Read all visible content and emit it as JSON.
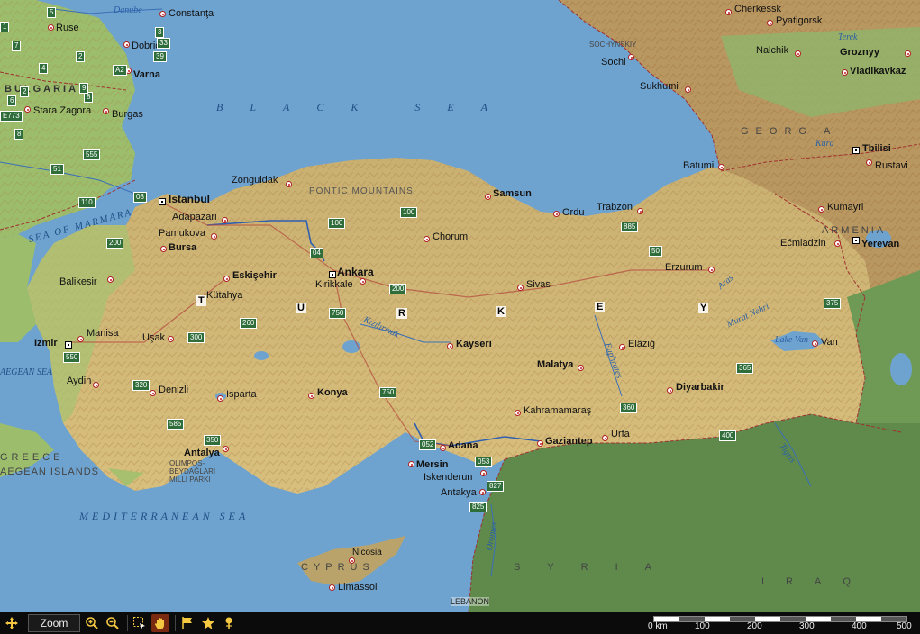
{
  "seas": {
    "black_sea": "BLACK SEA",
    "sea_of_marmara": "SEA OF MARMARA",
    "mediterranean": "MEDITERRANEAN SEA",
    "aegean": "AEGEAN SEA"
  },
  "countries": {
    "turkey": [
      "T",
      "U",
      "R",
      "K",
      "E",
      "Y"
    ],
    "bulgaria": "BULGARIA",
    "georgia": "GEORGIA",
    "armenia": "ARMENIA",
    "greece": "GREECE",
    "aegean_islands": "AEGEAN ISLANDS",
    "syria": "SYRIA",
    "iraq": "IRAQ",
    "cyprus": "CYPRUS",
    "lebanon": "LEBANON"
  },
  "regions": {
    "pontic": "PONTIC MOUNTAINS",
    "olimpos": [
      "OLIMPOS-",
      "BEYDAĞLARI",
      "MILLI PARKI"
    ],
    "sochynskiy": "SOCHYNSKIY"
  },
  "rivers": {
    "danube": "Danube",
    "terek": "Terek",
    "kura": "Kura",
    "kizilirmak": "Kızılırmak",
    "euphrates": "Euphrates",
    "murat": "Murat Nehri",
    "tigris": "Tigris",
    "orontes": "Orontes",
    "lake_van": "Lake Van",
    "aras": "Aras"
  },
  "cities": {
    "constanta": "Constanţa",
    "ruse": "Ruse",
    "dobrich": "Dobrich",
    "varna": "Varna",
    "stara_zagora": "Stara Zagora",
    "burgas": "Burgas",
    "istanbul": "Istanbul",
    "zonguldak": "Zonguldak",
    "samsun": "Samsun",
    "ordu": "Ordu",
    "trabzon": "Trabzon",
    "batumi": "Batumi",
    "sochi": "Sochi",
    "sukhumi": "Sukhumi",
    "cherkessk": "Cherkessk",
    "pyatigorsk": "Pyatigorsk",
    "nalchik": "Nalchik",
    "groznyy": "Groznyy",
    "vladikavkaz": "Vladikavkaz",
    "tbilisi": "Tbilisi",
    "rustavi": "Rustavi",
    "kumayri": "Kumayri",
    "ecmiadzin": "Ećmiadzin",
    "yerevan": "Yerevan",
    "adapazari": "Adapazari",
    "pamukova": "Pamukova",
    "bursa": "Bursa",
    "eskisehir": "Eskişehir",
    "ankara": "Ankara",
    "kirikkale": "Kirikkale",
    "chorum": "Chorum",
    "sivas": "Sivas",
    "erzurum": "Erzurum",
    "balikesir": "Balikesir",
    "kutahya": "Kütahya",
    "manisa": "Manisa",
    "izmir": "Izmir",
    "usak": "Uşak",
    "aydin": "Aydin",
    "denizli": "Denizli",
    "isparta": "Isparta",
    "konya": "Konya",
    "kayseri": "Kayseri",
    "malatya": "Malatya",
    "elazig": "Elâziğ",
    "van": "Van",
    "diyarbakir": "Diyarbakir",
    "kahramanmaras": "Kahramamaraş",
    "urfa": "Urfa",
    "gaziantep": "Gaziantep",
    "adana": "Adana",
    "mersin": "Mersin",
    "iskenderun": "Iskenderun",
    "antakya": "Antakya",
    "antalya": "Antalya",
    "nicosia": "Nicosia",
    "limassol": "Limassol"
  },
  "roads": [
    "5",
    "3",
    "33",
    "2",
    "39",
    "4",
    "A2",
    "8",
    "9",
    "7",
    "E773",
    "6",
    "51",
    "555",
    "08",
    "110",
    "200",
    "100",
    "04",
    "100",
    "885",
    "50",
    "200",
    "750",
    "260",
    "300",
    "550",
    "320",
    "585",
    "350",
    "750",
    "052",
    "053",
    "827",
    "825",
    "375",
    "365",
    "360",
    "400",
    "1",
    "2",
    "8"
  ],
  "toolbar": {
    "zoom_label": "Zoom",
    "pan_icon": "move-arrows-icon",
    "zoom_in_icon": "zoom-in-icon",
    "zoom_out_icon": "zoom-out-icon",
    "select_icon": "select-rect-icon",
    "hand_icon": "hand-pan-icon",
    "flag_icon": "flag-icon",
    "star_icon": "star-icon",
    "pin_icon": "pin-icon"
  },
  "scale": {
    "ticks": [
      "0 km",
      "100",
      "200",
      "300",
      "400",
      "500"
    ]
  },
  "colors": {
    "sea": "#6fa3cf",
    "lowland": "#9dbf6a",
    "upland": "#d9c07a",
    "mountain": "#b48a4f",
    "syria_plain": "#5f8a4c"
  }
}
